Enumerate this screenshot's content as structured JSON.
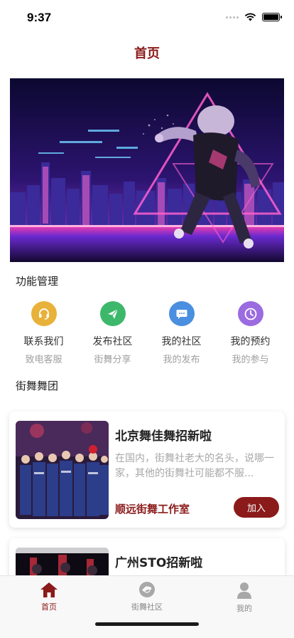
{
  "status": {
    "time": "9:37"
  },
  "nav": {
    "title": "首页"
  },
  "sections": {
    "functions": "功能管理",
    "groups": "街舞舞团"
  },
  "functions": [
    {
      "label": "联系我们",
      "sub": "致电客服",
      "icon": "headset-icon",
      "color": "#e8b13a"
    },
    {
      "label": "发布社区",
      "sub": "街舞分享",
      "icon": "paper-plane-icon",
      "color": "#3db86a"
    },
    {
      "label": "我的社区",
      "sub": "我的发布",
      "icon": "chat-bubble-icon",
      "color": "#4a8fe0"
    },
    {
      "label": "我的预约",
      "sub": "我的参与",
      "icon": "clock-icon",
      "color": "#9b6be0"
    }
  ],
  "cards": [
    {
      "title": "北京舞佳舞招新啦",
      "desc": "在国内，街舞社老大的名头，说哪一家，其他的街舞社可能都不服...",
      "studio": "顺远街舞工作室",
      "button": "加入"
    },
    {
      "title": "广州STO招新啦"
    }
  ],
  "tabs": [
    {
      "label": "首页",
      "icon": "home-icon",
      "active": true
    },
    {
      "label": "街舞社区",
      "icon": "community-icon",
      "active": false
    },
    {
      "label": "我的",
      "icon": "user-icon",
      "active": false
    }
  ],
  "colors": {
    "accent": "#8b1a1a"
  }
}
